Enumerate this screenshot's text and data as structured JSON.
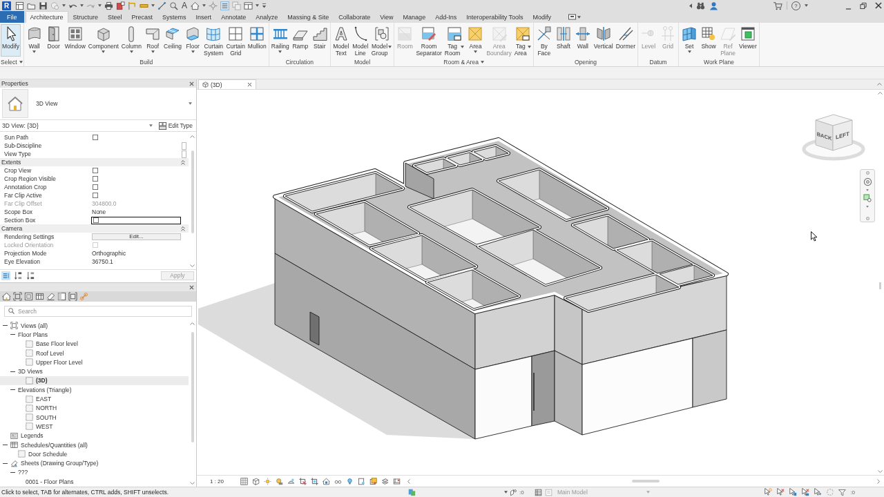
{
  "title_bar": {
    "logo": "R",
    "text_tool": "A",
    "help": "?"
  },
  "ribbon_tabs": [
    {
      "label": "File",
      "kind": "file",
      "selected": false
    },
    {
      "label": "Architecture",
      "kind": "tab",
      "selected": true
    },
    {
      "label": "Structure",
      "kind": "tab",
      "selected": false
    },
    {
      "label": "Steel",
      "kind": "tab",
      "selected": false
    },
    {
      "label": "Precast",
      "kind": "tab",
      "selected": false
    },
    {
      "label": "Systems",
      "kind": "tab",
      "selected": false
    },
    {
      "label": "Insert",
      "kind": "tab",
      "selected": false
    },
    {
      "label": "Annotate",
      "kind": "tab",
      "selected": false
    },
    {
      "label": "Analyze",
      "kind": "tab",
      "selected": false
    },
    {
      "label": "Massing & Site",
      "kind": "tab",
      "selected": false
    },
    {
      "label": "Collaborate",
      "kind": "tab",
      "selected": false
    },
    {
      "label": "View",
      "kind": "tab",
      "selected": false
    },
    {
      "label": "Manage",
      "kind": "tab",
      "selected": false
    },
    {
      "label": "Add-Ins",
      "kind": "tab",
      "selected": false
    },
    {
      "label": "Interoperability Tools",
      "kind": "tab",
      "selected": false
    },
    {
      "label": "Modify",
      "kind": "tab",
      "selected": false
    }
  ],
  "ribbon_panels": [
    {
      "title": "Select",
      "dropdown": true,
      "tools": [
        {
          "kind": "modify",
          "label": "Modify",
          "selected": true,
          "disabled": false,
          "dropdown": false
        }
      ]
    },
    {
      "title": "Build",
      "dropdown": false,
      "tools": [
        {
          "kind": "wall",
          "label": "Wall",
          "selected": false,
          "disabled": false,
          "dropdown": true
        },
        {
          "kind": "door",
          "label": "Door",
          "selected": false,
          "disabled": false,
          "dropdown": false
        },
        {
          "kind": "window",
          "label": "Window",
          "selected": false,
          "disabled": false,
          "dropdown": false
        },
        {
          "kind": "component",
          "label": "Component",
          "selected": false,
          "disabled": false,
          "dropdown": true
        },
        {
          "kind": "column",
          "label": "Column",
          "selected": false,
          "disabled": false,
          "dropdown": true
        },
        {
          "kind": "roof",
          "label": "Roof",
          "selected": false,
          "disabled": false,
          "dropdown": true
        },
        {
          "kind": "ceiling",
          "label": "Ceiling",
          "selected": false,
          "disabled": false,
          "dropdown": false
        },
        {
          "kind": "floor",
          "label": "Floor",
          "selected": false,
          "disabled": false,
          "dropdown": true
        },
        {
          "kind": "curtain_system",
          "label": "Curtain\nSystem",
          "selected": false,
          "disabled": false,
          "dropdown": false
        },
        {
          "kind": "curtain_grid",
          "label": "Curtain\nGrid",
          "selected": false,
          "disabled": false,
          "dropdown": false
        },
        {
          "kind": "mullion",
          "label": "Mullion",
          "selected": false,
          "disabled": false,
          "dropdown": false
        }
      ]
    },
    {
      "title": "Circulation",
      "dropdown": false,
      "tools": [
        {
          "kind": "railing",
          "label": "Railing",
          "selected": false,
          "disabled": false,
          "dropdown": true
        },
        {
          "kind": "ramp",
          "label": "Ramp",
          "selected": false,
          "disabled": false,
          "dropdown": false
        },
        {
          "kind": "stair",
          "label": "Stair",
          "selected": false,
          "disabled": false,
          "dropdown": false
        }
      ]
    },
    {
      "title": "Model",
      "dropdown": false,
      "tools": [
        {
          "kind": "model_text",
          "label": "Model\nText",
          "selected": false,
          "disabled": false,
          "dropdown": false
        },
        {
          "kind": "model_line",
          "label": "Model\nLine",
          "selected": false,
          "disabled": false,
          "dropdown": false
        },
        {
          "kind": "model_group",
          "label": "Model\nGroup",
          "selected": false,
          "disabled": false,
          "dropdown": true
        }
      ]
    },
    {
      "title": "Room & Area",
      "dropdown": true,
      "tools": [
        {
          "kind": "room",
          "label": "Room",
          "selected": false,
          "disabled": true,
          "dropdown": false
        },
        {
          "kind": "room_separator",
          "label": "Room\nSeparator",
          "selected": false,
          "disabled": false,
          "dropdown": false
        },
        {
          "kind": "tag_room",
          "label": "Tag\nRoom",
          "selected": false,
          "disabled": false,
          "dropdown": true
        },
        {
          "kind": "area",
          "label": "Area",
          "selected": false,
          "disabled": false,
          "dropdown": true
        },
        {
          "kind": "area_boundary",
          "label": "Area\nBoundary",
          "selected": false,
          "disabled": true,
          "dropdown": false
        },
        {
          "kind": "tag_area",
          "label": "Tag\nArea",
          "selected": false,
          "disabled": false,
          "dropdown": true
        }
      ]
    },
    {
      "title": "Opening",
      "dropdown": false,
      "tools": [
        {
          "kind": "by_face",
          "label": "By\nFace",
          "selected": false,
          "disabled": false,
          "dropdown": false
        },
        {
          "kind": "shaft",
          "label": "Shaft",
          "selected": false,
          "disabled": false,
          "dropdown": false
        },
        {
          "kind": "opening_wall",
          "label": "Wall",
          "selected": false,
          "disabled": false,
          "dropdown": false
        },
        {
          "kind": "vertical",
          "label": "Vertical",
          "selected": false,
          "disabled": false,
          "dropdown": false
        },
        {
          "kind": "dormer",
          "label": "Dormer",
          "selected": false,
          "disabled": false,
          "dropdown": false
        }
      ]
    },
    {
      "title": "Datum",
      "dropdown": false,
      "tools": [
        {
          "kind": "level",
          "label": "Level",
          "selected": false,
          "disabled": true,
          "dropdown": false
        },
        {
          "kind": "grid",
          "label": "Grid",
          "selected": false,
          "disabled": true,
          "dropdown": false
        }
      ]
    },
    {
      "title": "Work Plane",
      "dropdown": false,
      "tools": [
        {
          "kind": "set",
          "label": "Set",
          "selected": false,
          "disabled": false,
          "dropdown": true
        },
        {
          "kind": "show",
          "label": "Show",
          "selected": false,
          "disabled": false,
          "dropdown": false
        },
        {
          "kind": "ref_plane",
          "label": "Ref\nPlane",
          "selected": false,
          "disabled": true,
          "dropdown": false
        },
        {
          "kind": "viewer",
          "label": "Viewer",
          "selected": false,
          "disabled": false,
          "dropdown": false
        }
      ]
    }
  ],
  "properties": {
    "title": "Properties",
    "type_name": "3D View",
    "instance": "3D View: {3D}",
    "edit_type": "Edit Type",
    "rows": [
      {
        "kind": "check",
        "label": "Sun Path",
        "checked": false,
        "disabled": false,
        "selected": false
      },
      {
        "kind": "picker",
        "label": "Sub-Discipline",
        "disabled": false,
        "selected": false
      },
      {
        "kind": "picker",
        "label": "View Type",
        "disabled": false,
        "selected": false
      },
      {
        "kind": "group",
        "label": "Extents",
        "expanded": true
      },
      {
        "kind": "check",
        "label": "Crop View",
        "checked": false,
        "disabled": false,
        "selected": false
      },
      {
        "kind": "check",
        "label": "Crop Region Visible",
        "checked": false,
        "disabled": false,
        "selected": false
      },
      {
        "kind": "check",
        "label": "Annotation Crop",
        "checked": false,
        "disabled": false,
        "selected": false
      },
      {
        "kind": "check",
        "label": "Far Clip Active",
        "checked": false,
        "disabled": false,
        "selected": false
      },
      {
        "kind": "text",
        "label": "Far Clip Offset",
        "value": "304800.0",
        "disabled": true,
        "selected": false
      },
      {
        "kind": "text",
        "label": "Scope Box",
        "value": "None",
        "disabled": false,
        "selected": false
      },
      {
        "kind": "check",
        "label": "Section Box",
        "checked": false,
        "disabled": false,
        "selected": true
      },
      {
        "kind": "group",
        "label": "Camera",
        "expanded": true
      },
      {
        "kind": "button",
        "label": "Rendering Settings",
        "value": "Edit...",
        "disabled": false,
        "selected": false
      },
      {
        "kind": "check",
        "label": "Locked Orientation",
        "checked": false,
        "disabled": true,
        "selected": false
      },
      {
        "kind": "text",
        "label": "Projection Mode",
        "value": "Orthographic",
        "disabled": false,
        "selected": false
      },
      {
        "kind": "text",
        "label": "Eye Elevation",
        "value": "36750.1",
        "disabled": false,
        "selected": false
      }
    ],
    "apply": {
      "label": "Apply",
      "disabled": true
    }
  },
  "project_browser": {
    "search": {
      "placeholder": "Search"
    },
    "tree": [
      {
        "label": "Views (all)",
        "kind": "views",
        "expanded": true,
        "selected": false,
        "children": [
          {
            "label": "Floor Plans",
            "kind": "group",
            "expanded": true,
            "selected": false,
            "children": [
              {
                "label": "Base Floor level",
                "kind": "view",
                "selected": false
              },
              {
                "label": "Roof Level",
                "kind": "view",
                "selected": false
              },
              {
                "label": "Upper Floor Level",
                "kind": "view",
                "selected": false
              }
            ]
          },
          {
            "label": "3D Views",
            "kind": "group",
            "expanded": true,
            "selected": false,
            "children": [
              {
                "label": "(3D)",
                "kind": "view",
                "selected": true
              }
            ]
          },
          {
            "label": "Elevations (Triangle)",
            "kind": "group",
            "expanded": true,
            "selected": false,
            "children": [
              {
                "label": "EAST",
                "kind": "view",
                "selected": false
              },
              {
                "label": "NORTH",
                "kind": "view",
                "selected": false
              },
              {
                "label": "SOUTH",
                "kind": "view",
                "selected": false
              },
              {
                "label": "WEST",
                "kind": "view",
                "selected": false
              }
            ]
          }
        ]
      },
      {
        "label": "Legends",
        "kind": "legends",
        "selected": false
      },
      {
        "label": "Schedules/Quantities (all)",
        "kind": "schedules",
        "expanded": true,
        "selected": false,
        "children": [
          {
            "label": "Door Schedule",
            "kind": "view",
            "selected": false
          }
        ]
      },
      {
        "label": "Sheets (Drawing Group/Type)",
        "kind": "sheets",
        "expanded": true,
        "selected": false,
        "children": [
          {
            "label": "???",
            "kind": "group",
            "expanded": true,
            "selected": false,
            "children": [
              {
                "label": "0001 - Floor Plans",
                "kind": "sheet",
                "selected": false
              }
            ]
          }
        ]
      }
    ]
  },
  "view": {
    "tabs": [
      {
        "label": "(3D)",
        "selected": true
      }
    ],
    "view_cube": {
      "faces": [
        "BACK",
        "LEFT"
      ]
    },
    "scale": "1 : 20"
  },
  "status_bar": {
    "prompt": "Click to select, TAB for alternates, CTRL adds, SHIFT unselects.",
    "editable_count": ":0",
    "design_option": {
      "value": "Main Model",
      "disabled": true
    },
    "filter_count": ":0"
  }
}
